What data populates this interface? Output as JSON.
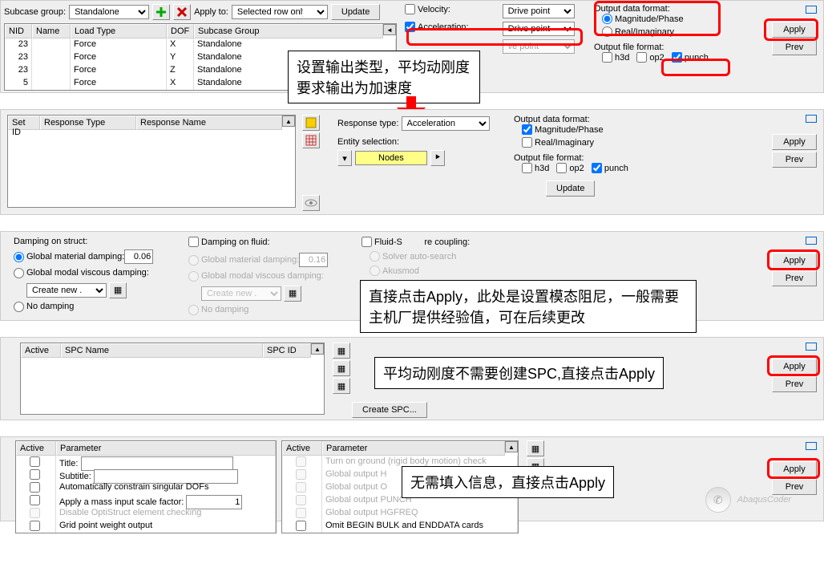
{
  "panel1": {
    "subcase_group_lbl": "Subcase group:",
    "subcase_group_val": "Standalone",
    "apply_to_lbl": "Apply to:",
    "apply_to_val": "Selected row only",
    "update_btn": "Update",
    "headers": {
      "nid": "NID",
      "name": "Name",
      "loadtype": "Load Type",
      "dof": "DOF",
      "subgroup": "Subcase Group"
    },
    "rows": [
      {
        "nid": "23",
        "name": "",
        "load": "Force",
        "dof": "X",
        "sub": "Standalone"
      },
      {
        "nid": "23",
        "name": "",
        "load": "Force",
        "dof": "Y",
        "sub": "Standalone"
      },
      {
        "nid": "23",
        "name": "",
        "load": "Force",
        "dof": "Z",
        "sub": "Standalone"
      },
      {
        "nid": "5",
        "name": "",
        "load": "Force",
        "dof": "X",
        "sub": "Standalone"
      }
    ],
    "velocity": "Velocity:",
    "velocity_val": "Drive point",
    "acceleration": "Acceleration:",
    "acceleration_val": "Drive point",
    "hidden_val": "ve point",
    "odf": "Output data format:",
    "mag": "Magnitude/Phase",
    "real": "Real/Imaginary",
    "off": "Output file format:",
    "h3d": "h3d",
    "op2": "op2",
    "punch": "punch",
    "apply": "Apply",
    "prev": "Prev"
  },
  "anno1": "设置输出类型，平均动刚度要求输出为加速度",
  "panel2": {
    "h_setid": "Set ID",
    "h_resptype": "Response Type",
    "h_respname": "Response Name",
    "resptype_lbl": "Response type:",
    "resptype_val": "Acceleration",
    "entity_lbl": "Entity selection:",
    "nodes": "Nodes",
    "odf": "Output data format:",
    "mag": "Magnitude/Phase",
    "real": "Real/Imaginary",
    "off": "Output file format:",
    "h3d": "h3d",
    "op2": "op2",
    "punch": "punch",
    "update": "Update",
    "apply": "Apply",
    "prev": "Prev"
  },
  "panel3": {
    "dos": "Damping on struct:",
    "gmd": "Global material damping:",
    "gmd_v": "0.06",
    "gmvd": "Global modal viscous damping:",
    "create": "Create new ...",
    "nodamp": "No damping",
    "dof": "Damping on fluid:",
    "gmd2_v": "0.16",
    "fsc": "Fluid-Structure coupling:",
    "fsc_partial": "re coupling:",
    "sas": "Solver auto-search",
    "akus": "Akusmod",
    "apply": "Apply",
    "prev": "Prev"
  },
  "anno3": "直接点击Apply，此处是设置模态阻尼，一般需要主机厂提供经验值，可在后续更改",
  "panel4": {
    "h_active": "Active",
    "h_spcname": "SPC Name",
    "h_spcid": "SPC ID",
    "create_spc": "Create SPC...",
    "apply": "Apply",
    "prev": "Prev"
  },
  "anno4": "平均动刚度不需要创建SPC,直接点击Apply",
  "panel5": {
    "h_active": "Active",
    "h_param": "Parameter",
    "p_title": "Title:",
    "p_sub": "Subtitle:",
    "p_auto": "Automatically constrain singular DOFs",
    "p_mass": "Apply a mass input scale factor:",
    "p_mass_v": "1",
    "p_opt": "Disable OptiStruct element checking",
    "p_grid": "Grid point weight output",
    "r_ground": "Turn on ground (rigid body motion) check",
    "r_gh": "Global output H",
    "r_go": "Global output O",
    "r_gp": "Global output PUNCH",
    "r_hg": "Global output HGFREQ",
    "r_omit": "Omit BEGIN BULK and ENDDATA cards",
    "apply": "Apply",
    "prev": "Prev"
  },
  "anno5": "无需填入信息，直接点击Apply",
  "watermark": "AbaqusCoder"
}
